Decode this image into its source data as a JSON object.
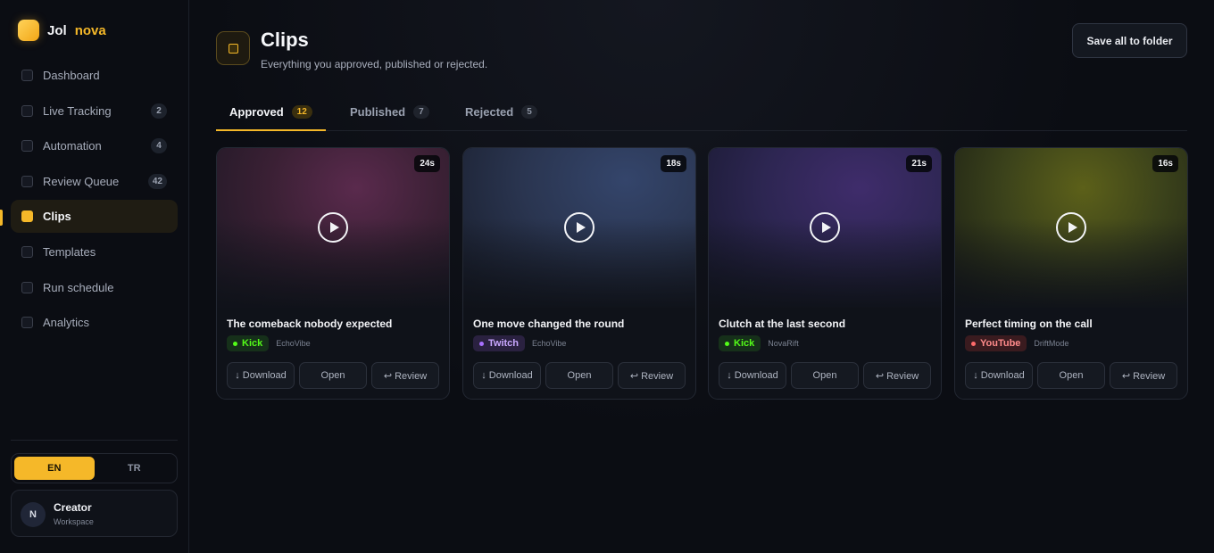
{
  "brand": {
    "name_a": "Jol",
    "name_b": "nova"
  },
  "nav": [
    {
      "label": "Dashboard",
      "badge": ""
    },
    {
      "label": "Live Tracking",
      "badge": "2"
    },
    {
      "label": "Automation",
      "badge": "4"
    },
    {
      "label": "Review Queue",
      "badge": "42"
    },
    {
      "label": "Clips",
      "badge": "",
      "active": true
    },
    {
      "label": "Templates",
      "badge": ""
    },
    {
      "label": "Run schedule",
      "badge": ""
    },
    {
      "label": "Analytics",
      "badge": ""
    }
  ],
  "lang": {
    "en": "EN",
    "tr": "TR",
    "selected": "EN"
  },
  "user": {
    "initial": "N",
    "name": "Creator",
    "role": "Workspace"
  },
  "page": {
    "title": "Clips",
    "subtitle": "Everything you approved, published or rejected.",
    "save_all": "Save all to folder"
  },
  "tabs": [
    {
      "label": "Approved",
      "count": "12",
      "active": true
    },
    {
      "label": "Published",
      "count": "7"
    },
    {
      "label": "Rejected",
      "count": "5"
    }
  ],
  "clips": [
    {
      "title": "The comeback nobody expected",
      "duration": "24s",
      "platform": "Kick",
      "channel": "EchoVibe"
    },
    {
      "title": "One move changed the round",
      "duration": "18s",
      "platform": "Twitch",
      "channel": "EchoVibe"
    },
    {
      "title": "Clutch at the last second",
      "duration": "21s",
      "platform": "Kick",
      "channel": "NovaRift"
    },
    {
      "title": "Perfect timing on the call",
      "duration": "16s",
      "platform": "YouTube",
      "channel": "DriftMode"
    }
  ],
  "card_actions": {
    "download": "↓ Download",
    "open": "Open",
    "review": "↩ Review"
  },
  "colors": {
    "accent": "#f5b829",
    "kick": "#53fc18",
    "twitch": "#a970ff",
    "youtube": "#ff6b6b"
  }
}
